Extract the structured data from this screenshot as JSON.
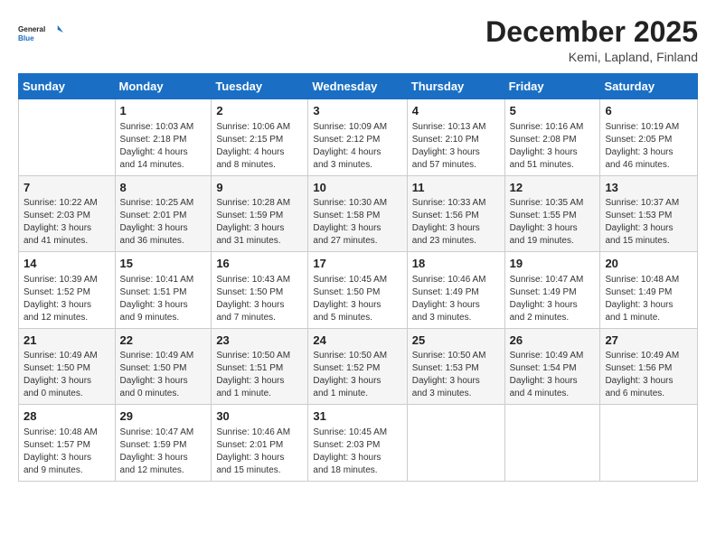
{
  "logo": {
    "line1": "General",
    "line2": "Blue"
  },
  "title": "December 2025",
  "location": "Kemi, Lapland, Finland",
  "days_of_week": [
    "Sunday",
    "Monday",
    "Tuesday",
    "Wednesday",
    "Thursday",
    "Friday",
    "Saturday"
  ],
  "weeks": [
    [
      {
        "day": "",
        "info": ""
      },
      {
        "day": "1",
        "info": "Sunrise: 10:03 AM\nSunset: 2:18 PM\nDaylight: 4 hours\nand 14 minutes."
      },
      {
        "day": "2",
        "info": "Sunrise: 10:06 AM\nSunset: 2:15 PM\nDaylight: 4 hours\nand 8 minutes."
      },
      {
        "day": "3",
        "info": "Sunrise: 10:09 AM\nSunset: 2:12 PM\nDaylight: 4 hours\nand 3 minutes."
      },
      {
        "day": "4",
        "info": "Sunrise: 10:13 AM\nSunset: 2:10 PM\nDaylight: 3 hours\nand 57 minutes."
      },
      {
        "day": "5",
        "info": "Sunrise: 10:16 AM\nSunset: 2:08 PM\nDaylight: 3 hours\nand 51 minutes."
      },
      {
        "day": "6",
        "info": "Sunrise: 10:19 AM\nSunset: 2:05 PM\nDaylight: 3 hours\nand 46 minutes."
      }
    ],
    [
      {
        "day": "7",
        "info": "Sunrise: 10:22 AM\nSunset: 2:03 PM\nDaylight: 3 hours\nand 41 minutes."
      },
      {
        "day": "8",
        "info": "Sunrise: 10:25 AM\nSunset: 2:01 PM\nDaylight: 3 hours\nand 36 minutes."
      },
      {
        "day": "9",
        "info": "Sunrise: 10:28 AM\nSunset: 1:59 PM\nDaylight: 3 hours\nand 31 minutes."
      },
      {
        "day": "10",
        "info": "Sunrise: 10:30 AM\nSunset: 1:58 PM\nDaylight: 3 hours\nand 27 minutes."
      },
      {
        "day": "11",
        "info": "Sunrise: 10:33 AM\nSunset: 1:56 PM\nDaylight: 3 hours\nand 23 minutes."
      },
      {
        "day": "12",
        "info": "Sunrise: 10:35 AM\nSunset: 1:55 PM\nDaylight: 3 hours\nand 19 minutes."
      },
      {
        "day": "13",
        "info": "Sunrise: 10:37 AM\nSunset: 1:53 PM\nDaylight: 3 hours\nand 15 minutes."
      }
    ],
    [
      {
        "day": "14",
        "info": "Sunrise: 10:39 AM\nSunset: 1:52 PM\nDaylight: 3 hours\nand 12 minutes."
      },
      {
        "day": "15",
        "info": "Sunrise: 10:41 AM\nSunset: 1:51 PM\nDaylight: 3 hours\nand 9 minutes."
      },
      {
        "day": "16",
        "info": "Sunrise: 10:43 AM\nSunset: 1:50 PM\nDaylight: 3 hours\nand 7 minutes."
      },
      {
        "day": "17",
        "info": "Sunrise: 10:45 AM\nSunset: 1:50 PM\nDaylight: 3 hours\nand 5 minutes."
      },
      {
        "day": "18",
        "info": "Sunrise: 10:46 AM\nSunset: 1:49 PM\nDaylight: 3 hours\nand 3 minutes."
      },
      {
        "day": "19",
        "info": "Sunrise: 10:47 AM\nSunset: 1:49 PM\nDaylight: 3 hours\nand 2 minutes."
      },
      {
        "day": "20",
        "info": "Sunrise: 10:48 AM\nSunset: 1:49 PM\nDaylight: 3 hours\nand 1 minute."
      }
    ],
    [
      {
        "day": "21",
        "info": "Sunrise: 10:49 AM\nSunset: 1:50 PM\nDaylight: 3 hours\nand 0 minutes."
      },
      {
        "day": "22",
        "info": "Sunrise: 10:49 AM\nSunset: 1:50 PM\nDaylight: 3 hours\nand 0 minutes."
      },
      {
        "day": "23",
        "info": "Sunrise: 10:50 AM\nSunset: 1:51 PM\nDaylight: 3 hours\nand 1 minute."
      },
      {
        "day": "24",
        "info": "Sunrise: 10:50 AM\nSunset: 1:52 PM\nDaylight: 3 hours\nand 1 minute."
      },
      {
        "day": "25",
        "info": "Sunrise: 10:50 AM\nSunset: 1:53 PM\nDaylight: 3 hours\nand 3 minutes."
      },
      {
        "day": "26",
        "info": "Sunrise: 10:49 AM\nSunset: 1:54 PM\nDaylight: 3 hours\nand 4 minutes."
      },
      {
        "day": "27",
        "info": "Sunrise: 10:49 AM\nSunset: 1:56 PM\nDaylight: 3 hours\nand 6 minutes."
      }
    ],
    [
      {
        "day": "28",
        "info": "Sunrise: 10:48 AM\nSunset: 1:57 PM\nDaylight: 3 hours\nand 9 minutes."
      },
      {
        "day": "29",
        "info": "Sunrise: 10:47 AM\nSunset: 1:59 PM\nDaylight: 3 hours\nand 12 minutes."
      },
      {
        "day": "30",
        "info": "Sunrise: 10:46 AM\nSunset: 2:01 PM\nDaylight: 3 hours\nand 15 minutes."
      },
      {
        "day": "31",
        "info": "Sunrise: 10:45 AM\nSunset: 2:03 PM\nDaylight: 3 hours\nand 18 minutes."
      },
      {
        "day": "",
        "info": ""
      },
      {
        "day": "",
        "info": ""
      },
      {
        "day": "",
        "info": ""
      }
    ]
  ]
}
